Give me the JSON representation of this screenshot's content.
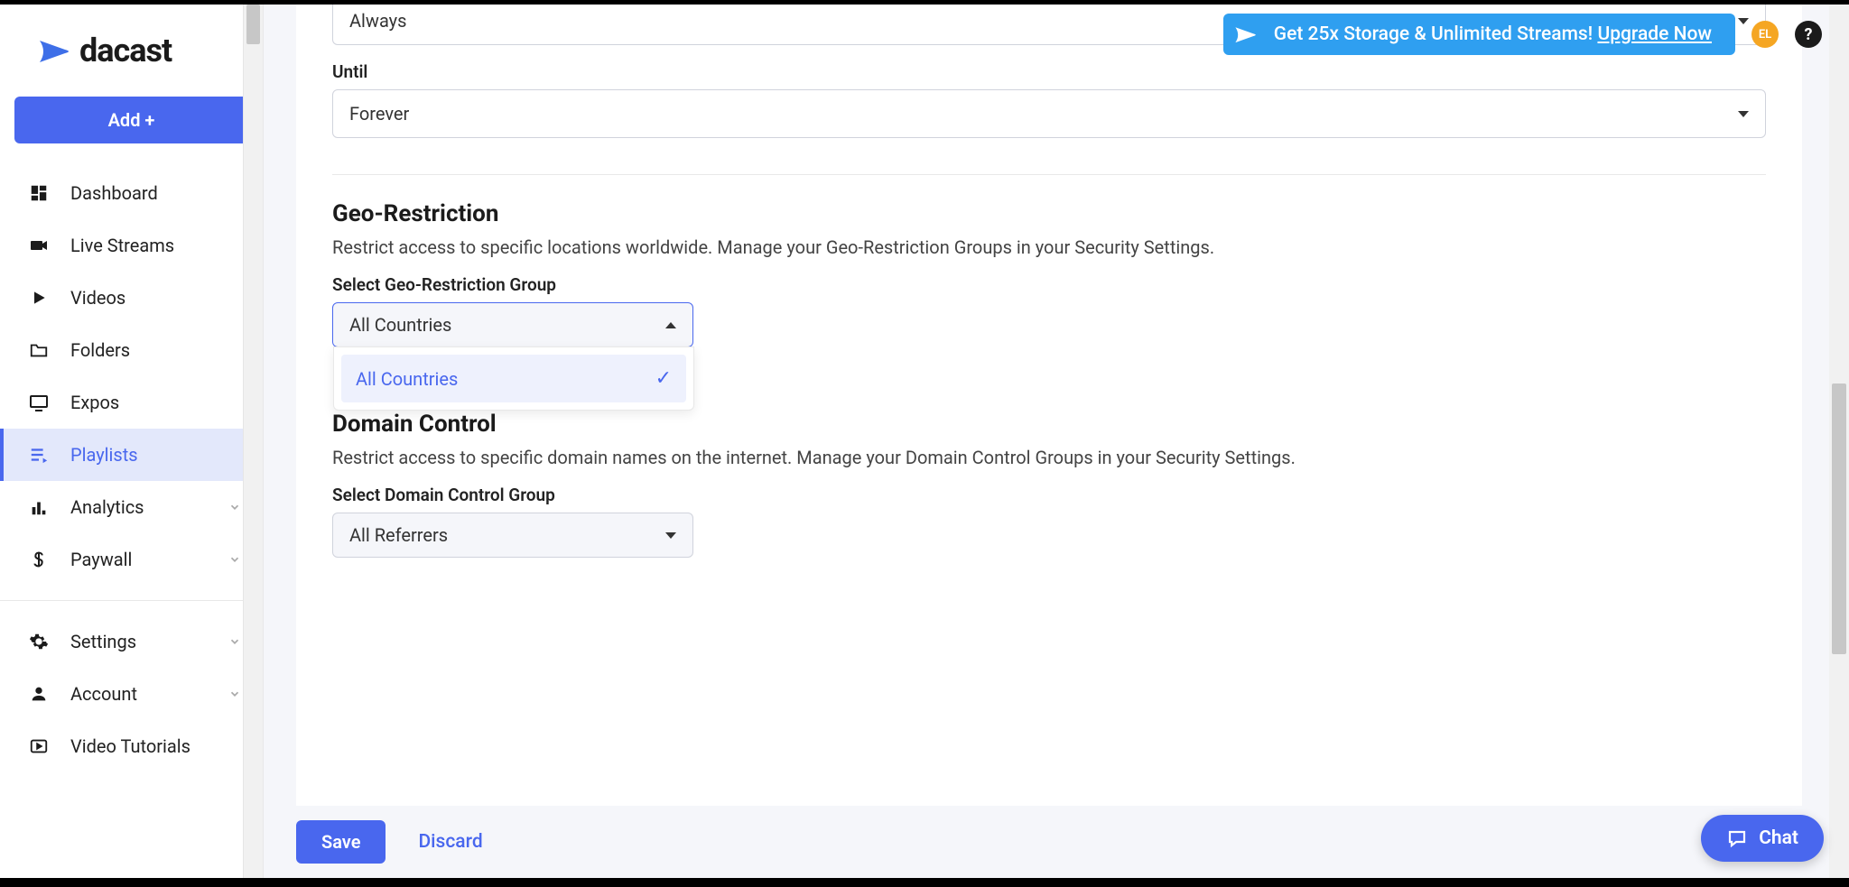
{
  "brand": {
    "name": "dacast"
  },
  "topbar": {
    "promo_text": "Get 25x Storage & Unlimited Streams! ",
    "promo_link": "Upgrade Now",
    "avatar_initials": "EL"
  },
  "sidebar": {
    "add_label": "Add +",
    "items": [
      {
        "label": "Dashboard",
        "icon": "dashboard"
      },
      {
        "label": "Live Streams",
        "icon": "camera"
      },
      {
        "label": "Videos",
        "icon": "play"
      },
      {
        "label": "Folders",
        "icon": "folder"
      },
      {
        "label": "Expos",
        "icon": "monitor"
      },
      {
        "label": "Playlists",
        "icon": "playlist",
        "active": true
      },
      {
        "label": "Analytics",
        "icon": "bars",
        "expandable": true
      },
      {
        "label": "Paywall",
        "icon": "dollar",
        "expandable": true
      }
    ],
    "bottom_items": [
      {
        "label": "Settings",
        "icon": "gear",
        "expandable": true
      },
      {
        "label": "Account",
        "icon": "person",
        "expandable": true
      },
      {
        "label": "Video Tutorials",
        "icon": "tutorial"
      }
    ]
  },
  "form": {
    "always_field_value": "Always",
    "until_label": "Until",
    "until_value": "Forever",
    "geo": {
      "title": "Geo-Restriction",
      "desc": "Restrict access to specific locations worldwide. Manage your Geo-Restriction Groups in your Security Settings.",
      "select_label": "Select Geo-Restriction Group",
      "select_value": "All Countries",
      "options": [
        "All Countries"
      ]
    },
    "domain": {
      "title": "Domain Control",
      "desc": "Restrict access to specific domain names on the internet. Manage your Domain Control Groups in your Security Settings.",
      "select_label": "Select Domain Control Group",
      "select_value": "All Referrers"
    }
  },
  "footer": {
    "save": "Save",
    "discard": "Discard"
  },
  "chat": {
    "label": "Chat"
  }
}
